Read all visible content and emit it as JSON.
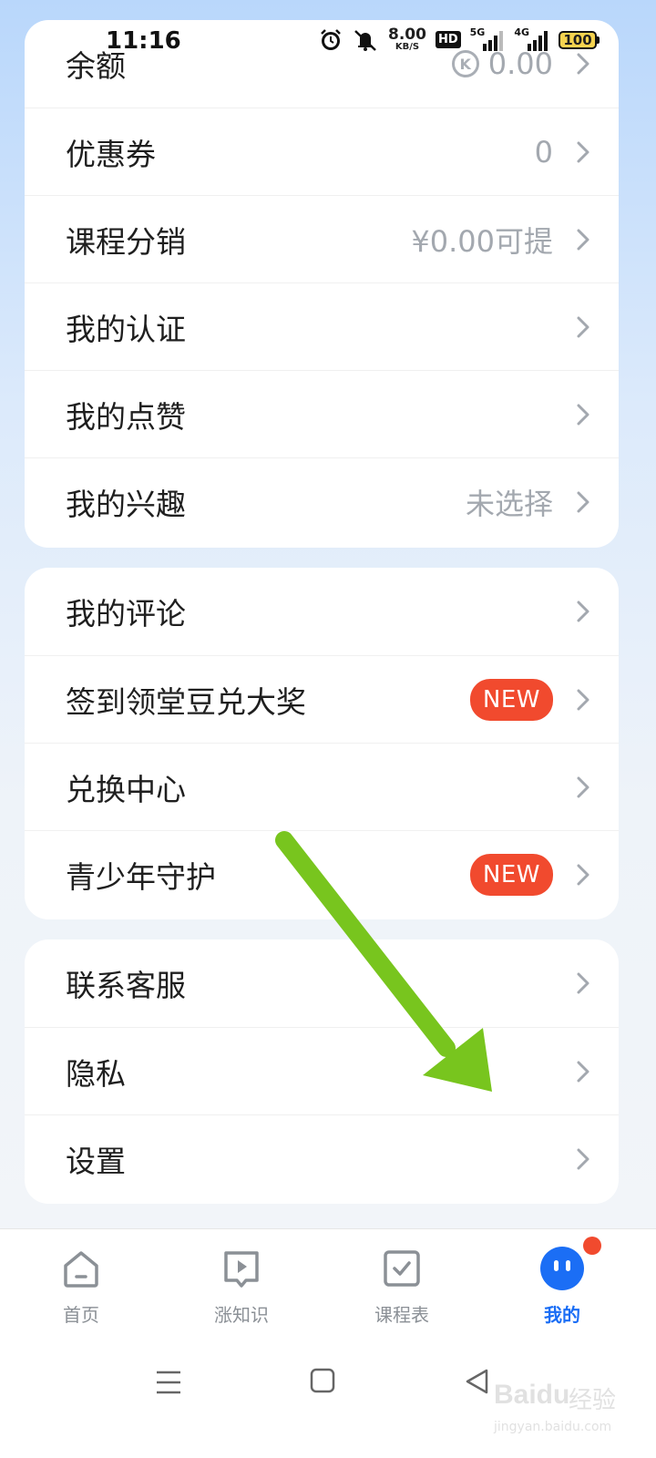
{
  "status_bar": {
    "time": "11:16",
    "net_speed_value": "8.00",
    "net_speed_unit": "KB/S",
    "hd": "HD",
    "sig1": "5G",
    "sig2": "4G",
    "battery": "100",
    "icons": [
      "alarm-icon",
      "mute-icon",
      "hd-icon",
      "signal-icon",
      "battery-icon"
    ]
  },
  "card1": {
    "balance": {
      "label": "余额",
      "value": "0.00"
    },
    "coupons": {
      "label": "优惠券",
      "value": "0"
    },
    "distribution": {
      "label": "课程分销",
      "value": "¥0.00可提"
    },
    "certification": {
      "label": "我的认证"
    },
    "likes": {
      "label": "我的点赞"
    },
    "interests": {
      "label": "我的兴趣",
      "value": "未选择"
    }
  },
  "card2": {
    "comments": {
      "label": "我的评论"
    },
    "checkin": {
      "label": "签到领堂豆兑大奖",
      "badge": "NEW"
    },
    "exchange": {
      "label": "兑换中心"
    },
    "youth": {
      "label": "青少年守护",
      "badge": "NEW"
    }
  },
  "card3": {
    "support": {
      "label": "联系客服"
    },
    "privacy": {
      "label": "隐私"
    },
    "settings": {
      "label": "设置"
    }
  },
  "tab_bar": {
    "tabs": [
      {
        "label": "首页",
        "icon": "home-icon"
      },
      {
        "label": "涨知识",
        "icon": "video-icon"
      },
      {
        "label": "课程表",
        "icon": "checklist-icon"
      },
      {
        "label": "我的",
        "icon": "profile-icon",
        "active": true
      }
    ]
  },
  "watermark": {
    "text": "Baidu",
    "cn": "经验",
    "url": "jingyan.baidu.com"
  },
  "colors": {
    "accent": "#1b6ef5",
    "badge_red": "#f14a2e",
    "arrow_green": "#78c51e"
  }
}
